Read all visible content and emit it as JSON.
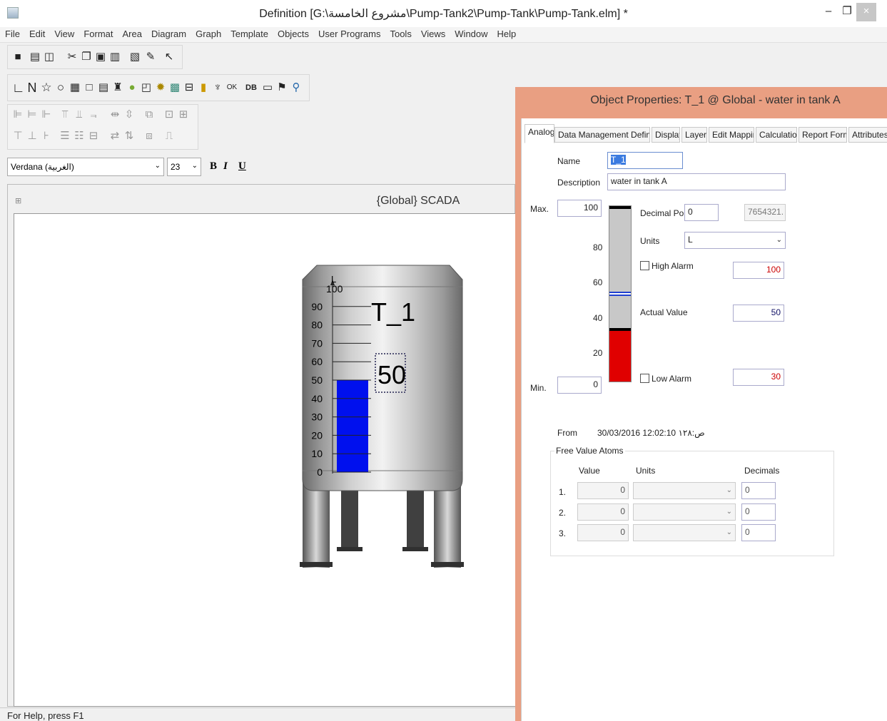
{
  "window": {
    "title": "Definition [G:\\مشروع الخامسة\\Pump-Tank2\\Pump-Tank\\Pump-Tank.elm] *",
    "min": "–",
    "max": "❐",
    "close": "×"
  },
  "menu": [
    "File",
    "Edit",
    "View",
    "Format",
    "Area",
    "Diagram",
    "Graph",
    "Template",
    "Objects",
    "User Programs",
    "Tools",
    "Views",
    "Window",
    "Help"
  ],
  "font_bar": {
    "font": "Verdana (الغربية)",
    "size": "23",
    "bold": "B",
    "italic": "I",
    "underline": "U"
  },
  "scada": {
    "title": "{Global} SCADA",
    "tank_label": "T_1",
    "tank_value": "50",
    "unit": "L",
    "level_percent": 50,
    "scale": [
      "100",
      "90",
      "80",
      "70",
      "60",
      "50",
      "40",
      "30",
      "20",
      "10",
      "0"
    ]
  },
  "status": "For Help, press F1",
  "props": {
    "title": "Object Properties: T_1 @ Global - water in tank A",
    "tabs": [
      "Analog",
      "Data Management Definitions",
      "Display",
      "Layers",
      "Edit Mapping",
      "Calculation",
      "Report Format",
      "Attributes"
    ],
    "name_label": "Name",
    "name": "T_1",
    "desc_label": "Description",
    "desc": "water in tank A",
    "max_label": "Max.",
    "max": "100",
    "min_label": "Min.",
    "min": "0",
    "scale": [
      "80",
      "60",
      "40",
      "20"
    ],
    "decimal_label": "Decimal Point",
    "decimal": "0",
    "format_preview": "7654321.",
    "units_label": "Units",
    "units": "L",
    "high_alarm_label": "High Alarm",
    "high_alarm": "100",
    "actual_label": "Actual Value",
    "actual": "50",
    "low_alarm_label": "Low Alarm",
    "low_alarm": "30",
    "from_label": "From",
    "from": "30/03/2016 12:02:10 ص:١٢٨",
    "fva_label": "Free Value Atoms",
    "col_value": "Value",
    "col_units": "Units",
    "col_decimals": "Decimals",
    "rows": [
      {
        "n": "1.",
        "value": "0",
        "decimals": "0"
      },
      {
        "n": "2.",
        "value": "0",
        "decimals": "0"
      },
      {
        "n": "3.",
        "value": "0",
        "decimals": "0"
      }
    ],
    "colors": {
      "alarm_red": "#e00000",
      "actual_blue": "#2040d0"
    }
  }
}
